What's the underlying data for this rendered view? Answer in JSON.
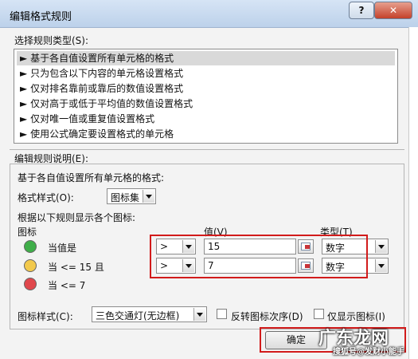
{
  "window": {
    "title": "编辑格式规则",
    "help_label": "?",
    "close_label": "✕"
  },
  "rule_types": {
    "label": "选择规则类型(S):",
    "items": [
      "基于各自值设置所有单元格的格式",
      "只为包含以下内容的单元格设置格式",
      "仅对排名靠前或靠后的数值设置格式",
      "仅对高于或低于平均值的数值设置格式",
      "仅对唯一值或重复值设置格式",
      "使用公式确定要设置格式的单元格"
    ],
    "bullet": "►",
    "selected_index": 0
  },
  "description": {
    "label": "编辑规则说明(E):",
    "intro": "基于各自值设置所有单元格的格式:",
    "format_style_label": "格式样式(O):",
    "format_style_value": "图标集",
    "rules_caption": "根据以下规则显示各个图标:",
    "icon_header": "图标",
    "value_header": "值(V)",
    "type_header": "类型(T)",
    "rows": [
      {
        "light": "green",
        "condition": "当值是",
        "operator": ">",
        "value": "15",
        "type": "数字"
      },
      {
        "light": "yellow",
        "condition": "当 <= 15 且",
        "operator": ">",
        "value": "7",
        "type": "数字"
      },
      {
        "light": "red",
        "condition": "当 <= 7"
      }
    ],
    "icon_style_label": "图标样式(C):",
    "icon_style_value": "三色交通灯(无边框)",
    "reverse_order_label": "反转图标次序(D)",
    "reverse_order_checked": false,
    "show_icon_only_label": "仅显示图标(I)",
    "show_icon_only_checked": false
  },
  "buttons": {
    "ok": "确定"
  },
  "watermark": {
    "main": "广东龙网",
    "sub": "搜狐号@发财小能手"
  },
  "colors": {
    "green": "#3fae49",
    "yellow": "#f2c94c",
    "red": "#e0474c",
    "highlight": "#d21b1b"
  }
}
